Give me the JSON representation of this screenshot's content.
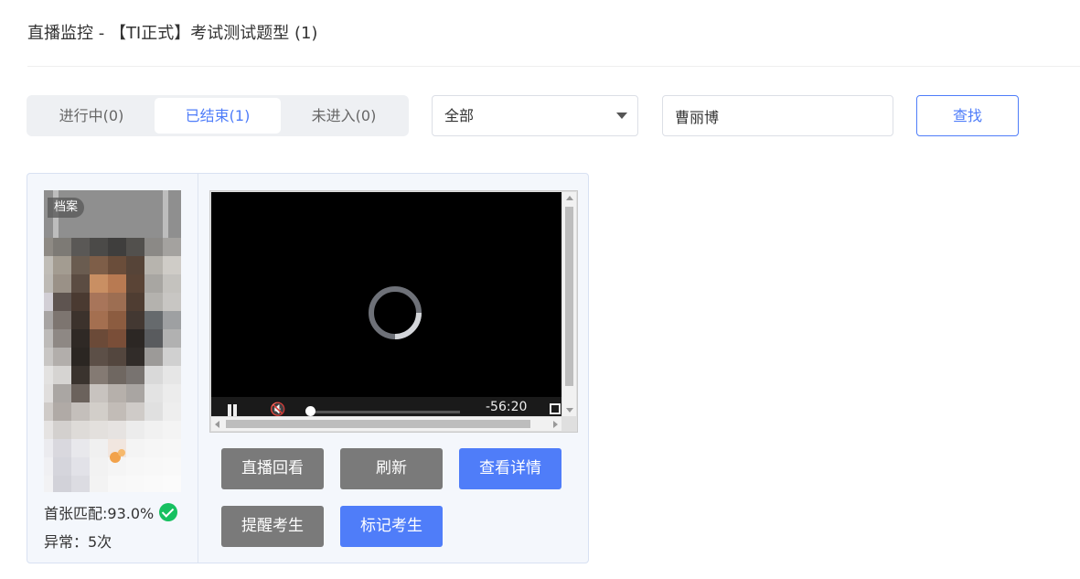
{
  "page": {
    "title": "直播监控 - 【TI正式】考试测试题型 (1)"
  },
  "tabs": [
    {
      "label": "进行中(0)",
      "active": false
    },
    {
      "label": "已结束(1)",
      "active": true
    },
    {
      "label": "未进入(0)",
      "active": false
    }
  ],
  "filter": {
    "selected": "全部"
  },
  "search": {
    "value": "曹丽博",
    "button_label": "查找"
  },
  "card": {
    "archive_badge": "档案",
    "match_text": "首张匹配:93.0%",
    "abnormal_text": "异常：5次",
    "video": {
      "time": "-56:20"
    },
    "buttons": {
      "replay": "直播回看",
      "refresh": "刷新",
      "details": "查看详情",
      "remind": "提醒考生",
      "mark": "标记考生"
    }
  },
  "colors": {
    "accent": "#4f7df9",
    "gray_button": "#7a7a7a",
    "success": "#16c060"
  }
}
